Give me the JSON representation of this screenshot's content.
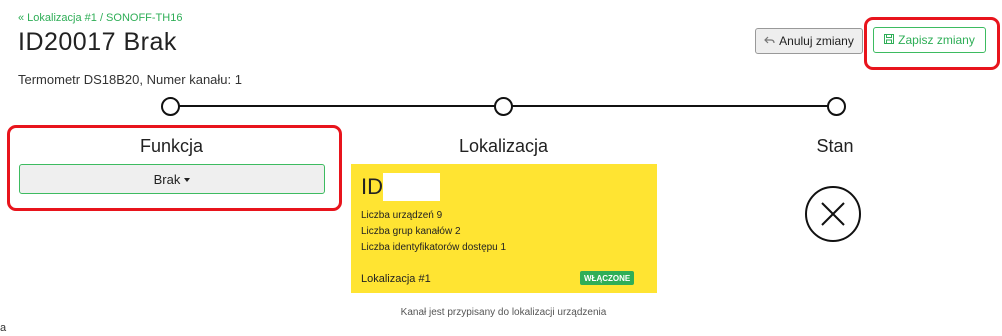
{
  "header": {
    "breadcrumb": "« Lokalizacja #1 / SONOFF-TH16",
    "title": "ID20017 Brak",
    "subtitle": "Termometr DS18B20, Numer kanału: 1"
  },
  "actions": {
    "cancel_label": "Anuluj zmiany",
    "save_label": "Zapisz zmiany"
  },
  "columns": {
    "function": {
      "heading": "Funkcja",
      "selected": "Brak"
    },
    "location": {
      "heading": "Lokalizacja",
      "card": {
        "id_prefix": "ID",
        "devices": {
          "label": "Liczba urządzeń",
          "value": "9"
        },
        "channel_groups": {
          "label": "Liczba grup kanałów",
          "value": "2"
        },
        "access_ids": {
          "label": "Liczba identyfikatorów dostępu",
          "value": "1"
        },
        "name": "Lokalizacja #1",
        "badge": "WŁĄCZONE"
      },
      "note": "Kanał jest przypisany do lokalizacji urządzenia"
    },
    "state": {
      "heading": "Stan",
      "icon": "x-circle-icon"
    }
  },
  "colors": {
    "accent_green": "#2fae57",
    "card_yellow": "#ffe432",
    "highlight_red": "#e8141c"
  },
  "edge_text": "a"
}
